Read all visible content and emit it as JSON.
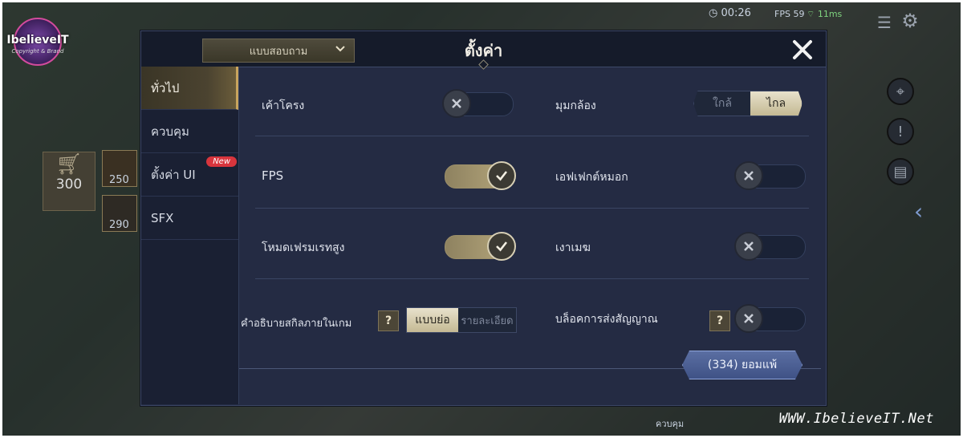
{
  "logo": {
    "brand": "IbelieveIT",
    "tagline": "Copyright & Brand"
  },
  "hud": {
    "timer": "00:26",
    "fps": "FPS 59",
    "ping": "11ms",
    "coins": "300",
    "item1": "250",
    "item2": "290"
  },
  "dropdown": {
    "value": "แบบสอบถาม"
  },
  "title": "ตั้งค่า",
  "sidebar": {
    "items": [
      {
        "label": "ทั่วไป",
        "active": true
      },
      {
        "label": "ควบคุม"
      },
      {
        "label": "ตั้งค่า UI",
        "badge": "New"
      },
      {
        "label": "SFX"
      }
    ]
  },
  "settings": {
    "outline": {
      "label": "เค้าโครง",
      "state": "off"
    },
    "camera": {
      "label": "มุมกล้อง",
      "options": [
        "ใกล้",
        "ไกล"
      ],
      "selected": "ไกล"
    },
    "fps": {
      "label": "FPS",
      "state": "on"
    },
    "fog": {
      "label": "เอฟเฟกต์หมอก",
      "state": "off"
    },
    "high_fps": {
      "label": "โหมดเฟรมเรทสูง",
      "state": "on"
    },
    "shadow": {
      "label": "เงาเมฆ",
      "state": "off"
    },
    "skill_desc": {
      "label": "คำอธิบายสกิลภายในเกม",
      "options": [
        "แบบย่อ",
        "รายละเอียด"
      ],
      "selected": "แบบย่อ"
    },
    "block_signal": {
      "label": "บล็อคการส่งสัญญาณ",
      "state": "off"
    }
  },
  "help_label": "?",
  "surrender": {
    "label": "(334)  ยอมแพ้"
  },
  "bottom_label": "ควบคุม",
  "watermark": "WWW.IbelieveIT.Net",
  "colors": {
    "panel": "#242b43",
    "accent_gold": "#c8a45e",
    "badge_red": "#d8353d",
    "button_blue": "#4a5e94"
  }
}
